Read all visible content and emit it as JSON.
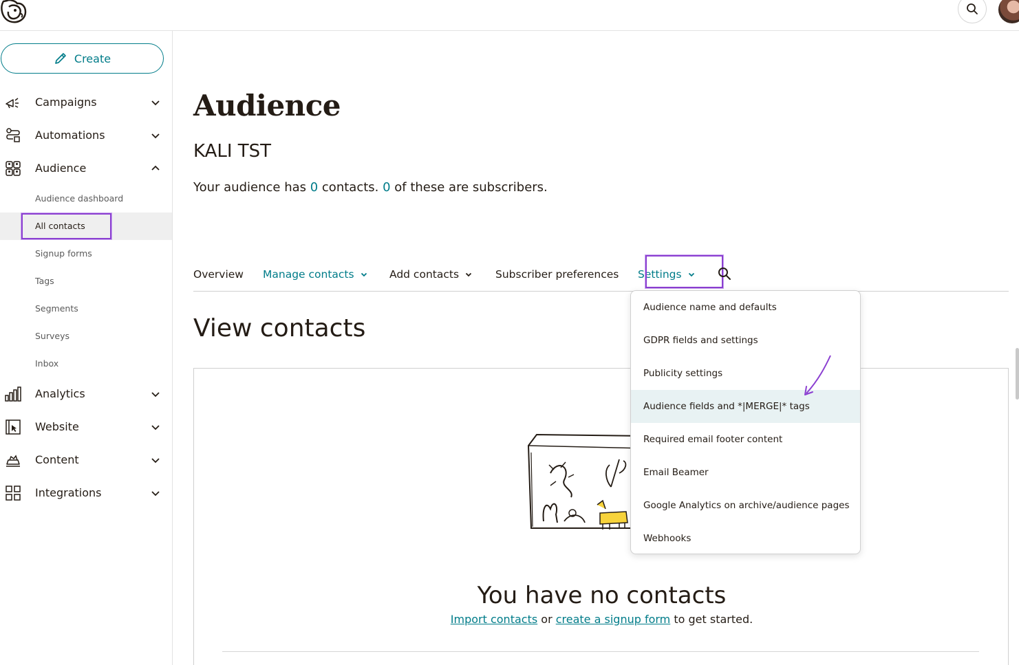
{
  "header": {
    "logo_icon": "mailchimp-freddie-icon",
    "search_icon": "search-icon",
    "avatar_icon": "user-avatar"
  },
  "sidebar": {
    "create_label": "Create",
    "nav": [
      {
        "label": "Campaigns",
        "icon": "megaphone-icon",
        "expanded": false
      },
      {
        "label": "Automations",
        "icon": "automation-icon",
        "expanded": false
      },
      {
        "label": "Audience",
        "icon": "audience-icon",
        "expanded": true
      },
      {
        "label": "Analytics",
        "icon": "bar-chart-icon",
        "expanded": false
      },
      {
        "label": "Website",
        "icon": "website-icon",
        "expanded": false
      },
      {
        "label": "Content",
        "icon": "content-icon",
        "expanded": false
      },
      {
        "label": "Integrations",
        "icon": "grid-icon",
        "expanded": false
      }
    ],
    "audience_sub": [
      {
        "label": "Audience dashboard"
      },
      {
        "label": "All contacts",
        "active": true
      },
      {
        "label": "Signup forms"
      },
      {
        "label": "Tags"
      },
      {
        "label": "Segments"
      },
      {
        "label": "Surveys"
      },
      {
        "label": "Inbox"
      }
    ]
  },
  "main": {
    "title": "Audience",
    "audience_name": "KALI TST",
    "summary": {
      "prefix": "Your audience has ",
      "contacts": "0",
      "middle": " contacts. ",
      "subscribers": "0",
      "suffix": " of these are subscribers."
    },
    "tabs": [
      {
        "label": "Overview",
        "has_menu": false
      },
      {
        "label": "Manage contacts",
        "has_menu": true
      },
      {
        "label": "Add contacts",
        "has_menu": true
      },
      {
        "label": "Subscriber preferences",
        "has_menu": false
      },
      {
        "label": "Settings",
        "has_menu": true,
        "open": true
      }
    ],
    "view_title": "View contacts",
    "empty": {
      "title": "You have no contacts",
      "import_link": "Import contacts",
      "or": " or ",
      "signup_link": "create a signup form",
      "suffix": " to get started."
    }
  },
  "settings_menu": {
    "items": [
      {
        "label": "Audience name and defaults"
      },
      {
        "label": "GDPR fields and settings"
      },
      {
        "label": "Publicity settings"
      },
      {
        "label": "Audience fields and *|MERGE|* tags",
        "hover": true
      },
      {
        "label": "Required email footer content"
      },
      {
        "label": "Email Beamer"
      },
      {
        "label": "Google Analytics on archive/audience pages"
      },
      {
        "label": "Webhooks"
      }
    ]
  },
  "colors": {
    "accent": "#007c89",
    "highlight": "#8b3fd1",
    "text": "#241c15",
    "hover_bg": "#e8f2f3"
  }
}
